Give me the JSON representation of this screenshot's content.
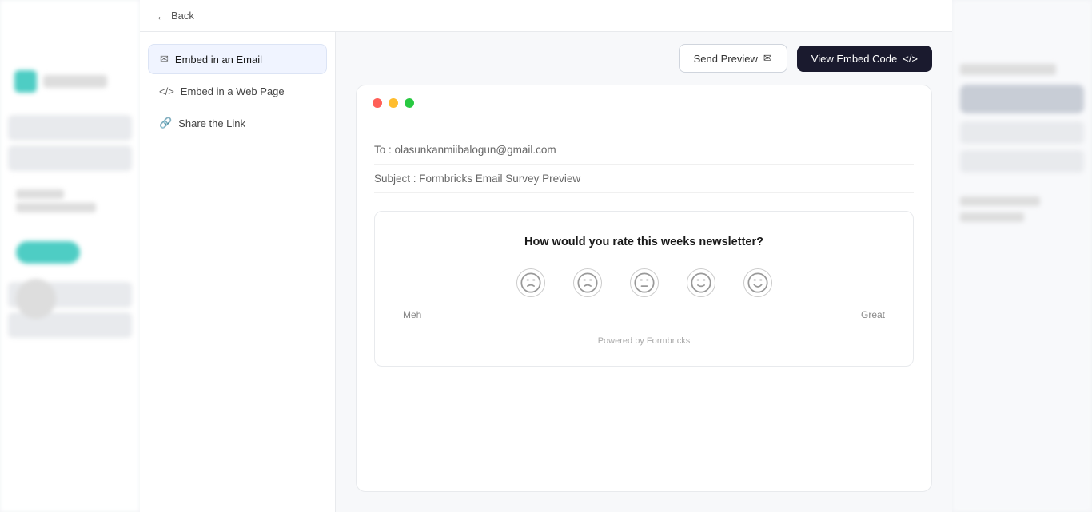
{
  "topBar": {
    "backLabel": "Back"
  },
  "nav": {
    "items": [
      {
        "id": "embed-email",
        "label": "Embed in an Email",
        "icon": "✉",
        "active": true
      },
      {
        "id": "embed-webpage",
        "label": "Embed in a Web Page",
        "icon": "</>",
        "active": false
      },
      {
        "id": "share-link",
        "label": "Share the Link",
        "icon": "🔗",
        "active": false
      }
    ]
  },
  "previewHeader": {
    "sendPreviewLabel": "Send Preview",
    "sendPreviewIcon": "✉",
    "viewEmbedLabel": "View Embed Code",
    "viewEmbedIcon": "</>"
  },
  "emailCard": {
    "toLabel": "To :",
    "toValue": "olasunkanmiibalogun@gmail.com",
    "subjectLabel": "Subject :",
    "subjectValue": "Formbricks Email Survey Preview"
  },
  "survey": {
    "question": "How would you rate this weeks newsletter?",
    "smileys": [
      "😞",
      "😟",
      "😐",
      "🙂",
      "😊"
    ],
    "labelLeft": "Meh",
    "labelRight": "Great",
    "poweredBy": "Powered by Formbricks"
  },
  "colors": {
    "dotRed": "#ff5f57",
    "dotYellow": "#ffbd2e",
    "dotGreen": "#28c941",
    "btnDark": "#1a1a2e",
    "btnLight": "#ffffff"
  }
}
